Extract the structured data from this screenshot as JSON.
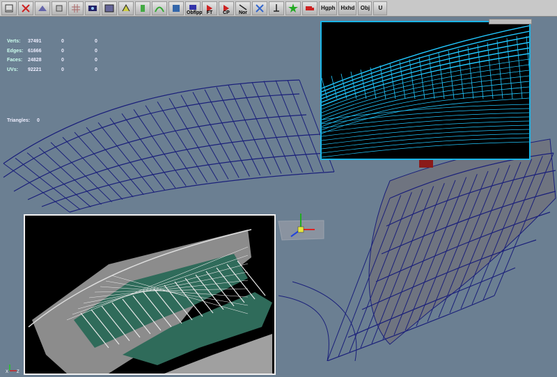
{
  "toolbar": {
    "buttons": [
      {
        "name": "shelf-menu-button",
        "icon": "shelf-menu-icon",
        "label": ""
      },
      {
        "name": "delete-button",
        "icon": "delete-icon",
        "label": ""
      },
      {
        "name": "plane-button",
        "icon": "plane-icon",
        "label": ""
      },
      {
        "name": "cube-button",
        "icon": "cube-icon",
        "label": ""
      },
      {
        "name": "grid-button",
        "icon": "grid-icon",
        "label": ""
      },
      {
        "name": "render-button",
        "icon": "render-icon",
        "label": ""
      },
      {
        "name": "texture-button",
        "icon": "texture-icon",
        "label": ""
      },
      {
        "name": "sweep-button",
        "icon": "sweep-icon",
        "label": ""
      },
      {
        "name": "paint-button",
        "icon": "paint-icon",
        "label": ""
      },
      {
        "name": "curve-button",
        "icon": "curve-icon",
        "label": ""
      },
      {
        "name": "lasso-button",
        "icon": "lasso-icon",
        "label": ""
      },
      {
        "name": "obflpp-button",
        "icon": "flip-icon",
        "label": "Obflpp"
      },
      {
        "name": "ft-button",
        "icon": "arrow-icon",
        "label": "FT"
      },
      {
        "name": "cp-button",
        "icon": "arrow-icon",
        "label": "CP"
      },
      {
        "name": "nor-button",
        "icon": "normal-icon",
        "label": "Nor"
      },
      {
        "name": "merge-button",
        "icon": "merge-icon",
        "label": ""
      },
      {
        "name": "snap-button",
        "icon": "snap-icon",
        "label": ""
      },
      {
        "name": "star-button",
        "icon": "star-icon",
        "label": ""
      },
      {
        "name": "truck-button",
        "icon": "truck-icon",
        "label": ""
      },
      {
        "name": "hgph-button",
        "icon": "",
        "label": "Hgph"
      },
      {
        "name": "hxhd-button",
        "icon": "",
        "label": "Hxhd"
      },
      {
        "name": "obj-button",
        "icon": "",
        "label": "Obj"
      },
      {
        "name": "u-button",
        "icon": "",
        "label": "U"
      }
    ]
  },
  "hud": {
    "rows": [
      {
        "label": "Verts:",
        "v1": "37491",
        "v2": "0",
        "v3": "0"
      },
      {
        "label": "Edges:",
        "v1": "61666",
        "v2": "0",
        "v3": "0"
      },
      {
        "label": "Faces:",
        "v1": "24828",
        "v2": "0",
        "v3": "0"
      },
      {
        "label": "UVs:",
        "v1": "92221",
        "v2": "0",
        "v3": "0"
      }
    ],
    "triangles_label": "Triangles:",
    "triangles_value": "0"
  },
  "colors": {
    "viewport_bg": "#6b7f92",
    "wireframe": "#1a1f7a",
    "inset_wire": "#22c8ff",
    "seats_green": "#2f6b5a",
    "seats_gray": "#8c8c8c"
  },
  "axes": {
    "x": "X",
    "y": "Y",
    "z": "Z"
  }
}
